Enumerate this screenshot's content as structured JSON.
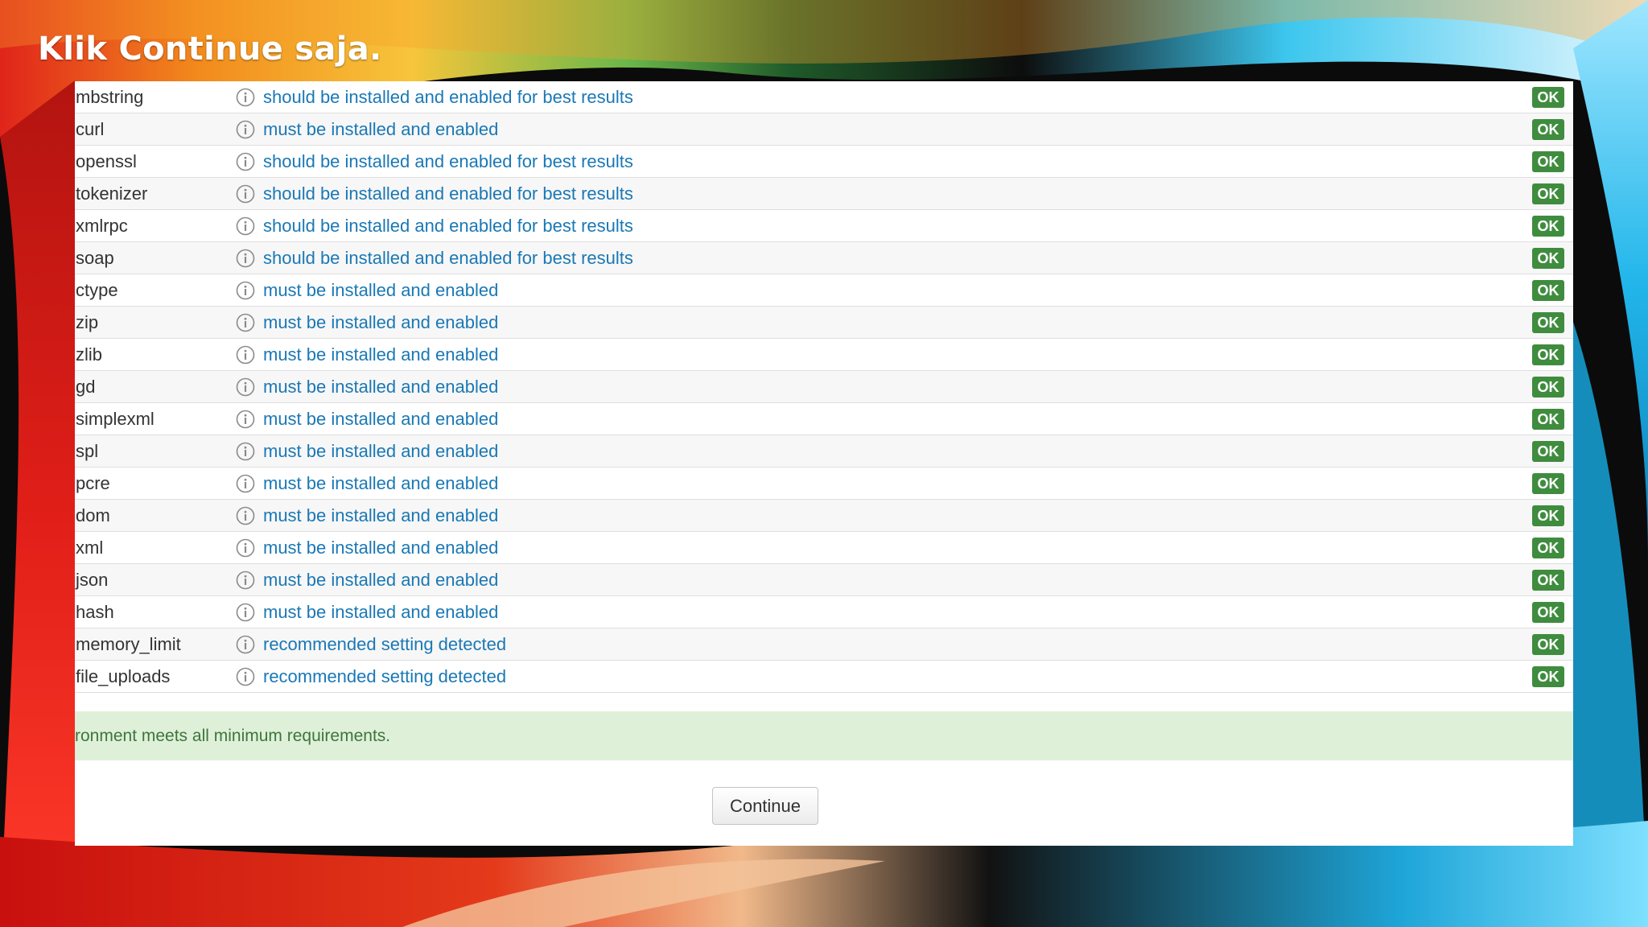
{
  "slide": {
    "title": "Klik Continue saja."
  },
  "requirements": [
    {
      "name": "mbstring",
      "message": "should be installed and enabled for best results",
      "status": "OK"
    },
    {
      "name": "curl",
      "message": "must be installed and enabled",
      "status": "OK"
    },
    {
      "name": "openssl",
      "message": "should be installed and enabled for best results",
      "status": "OK"
    },
    {
      "name": "tokenizer",
      "message": "should be installed and enabled for best results",
      "status": "OK"
    },
    {
      "name": "xmlrpc",
      "message": "should be installed and enabled for best results",
      "status": "OK"
    },
    {
      "name": "soap",
      "message": "should be installed and enabled for best results",
      "status": "OK"
    },
    {
      "name": "ctype",
      "message": "must be installed and enabled",
      "status": "OK"
    },
    {
      "name": "zip",
      "message": "must be installed and enabled",
      "status": "OK"
    },
    {
      "name": "zlib",
      "message": "must be installed and enabled",
      "status": "OK"
    },
    {
      "name": "gd",
      "message": "must be installed and enabled",
      "status": "OK"
    },
    {
      "name": "simplexml",
      "message": "must be installed and enabled",
      "status": "OK"
    },
    {
      "name": "spl",
      "message": "must be installed and enabled",
      "status": "OK"
    },
    {
      "name": "pcre",
      "message": "must be installed and enabled",
      "status": "OK"
    },
    {
      "name": "dom",
      "message": "must be installed and enabled",
      "status": "OK"
    },
    {
      "name": "xml",
      "message": "must be installed and enabled",
      "status": "OK"
    },
    {
      "name": "json",
      "message": "must be installed and enabled",
      "status": "OK"
    },
    {
      "name": "hash",
      "message": "must be installed and enabled",
      "status": "OK"
    },
    {
      "name": "memory_limit",
      "message": "recommended setting detected",
      "status": "OK"
    },
    {
      "name": "file_uploads",
      "message": "recommended setting detected",
      "status": "OK"
    }
  ],
  "info_icon": "info-circle-icon",
  "alert": {
    "text": "ronment meets all minimum requirements."
  },
  "actions": {
    "continue_label": "Continue"
  },
  "colors": {
    "message_link": "#1a78b5",
    "ok_badge": "#3f8c3f",
    "alert_background": "#dff0d8",
    "alert_text": "#3c763d"
  }
}
